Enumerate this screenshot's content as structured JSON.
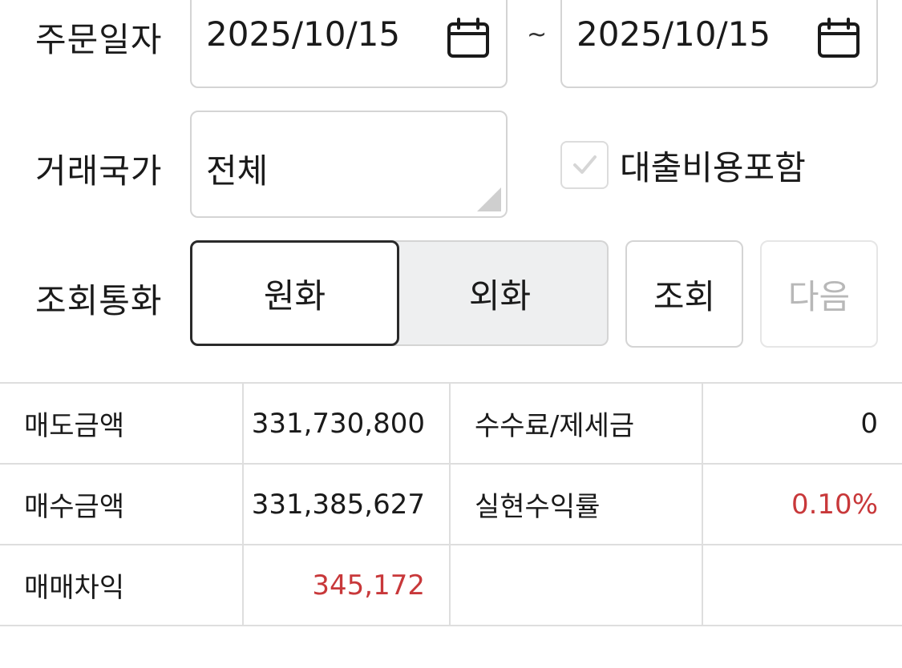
{
  "filters": {
    "order_date": {
      "label": "주문일자",
      "from": "2025/10/15",
      "separator": "~",
      "to": "2025/10/15"
    },
    "country": {
      "label": "거래국가",
      "value": "전체"
    },
    "include_loan_cost": {
      "label": "대출비용포함",
      "checked": true
    },
    "currency": {
      "label": "조회통화",
      "options": [
        "원화",
        "외화"
      ],
      "selected": "원화"
    },
    "search_button": "조회",
    "next_button": "다음"
  },
  "summary": {
    "sell_amount": {
      "label": "매도금액",
      "value": "331,730,800"
    },
    "fee_tax": {
      "label": "수수료/제세금",
      "value": "0"
    },
    "buy_amount": {
      "label": "매수금액",
      "value": "331,385,627"
    },
    "realized_return": {
      "label": "실현수익률",
      "value": "0.10%"
    },
    "trading_pnl": {
      "label": "매매차익",
      "value": "345,172"
    }
  },
  "colors": {
    "positive": "#c8383a",
    "border": "#d4d4d4",
    "selected_border": "#2a2a2a",
    "unselected_bg": "#eeeff0",
    "disabled_text": "#b8b8b8"
  }
}
